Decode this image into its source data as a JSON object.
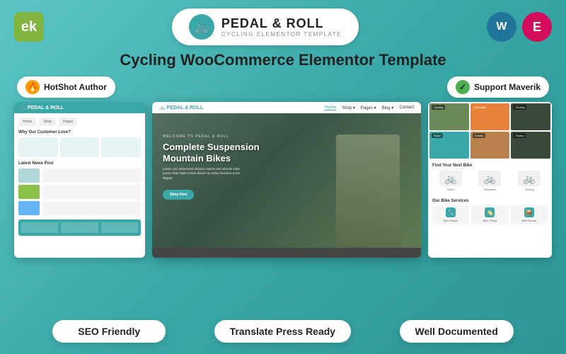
{
  "topBar": {
    "enviIcon": "ek",
    "logo": {
      "title": "PEDAL & ROLL",
      "subtitle": "CYCLING ELEMENTOR TEMPLATE"
    },
    "wpIcon": "W",
    "elIcon": "E"
  },
  "pageTitle": "Cycling WooCommerce Elementor Template",
  "authorBadge": {
    "label": "HotShot Author"
  },
  "supportBadge": {
    "label": "Support Maverik"
  },
  "centerPreview": {
    "heroSubtitle": "WELCOME TO PEDAL & ROLL",
    "heroTitle": "Complete Suspension\nMountain Bikes",
    "heroDesc": "Lorem orci elementum dictum viverra sed lobortis vitae purus Vitae eget cursus dictum ac tellus faucibus porta aliquet.",
    "heroBtnLabel": "Shop Now",
    "navLinks": [
      "Home",
      "Shop",
      "Pages",
      "Blog",
      "Contact"
    ]
  },
  "bottomBadges": {
    "seo": "SEO Friendly",
    "translate": "Translate Press Ready",
    "documented": "Well Documented"
  }
}
